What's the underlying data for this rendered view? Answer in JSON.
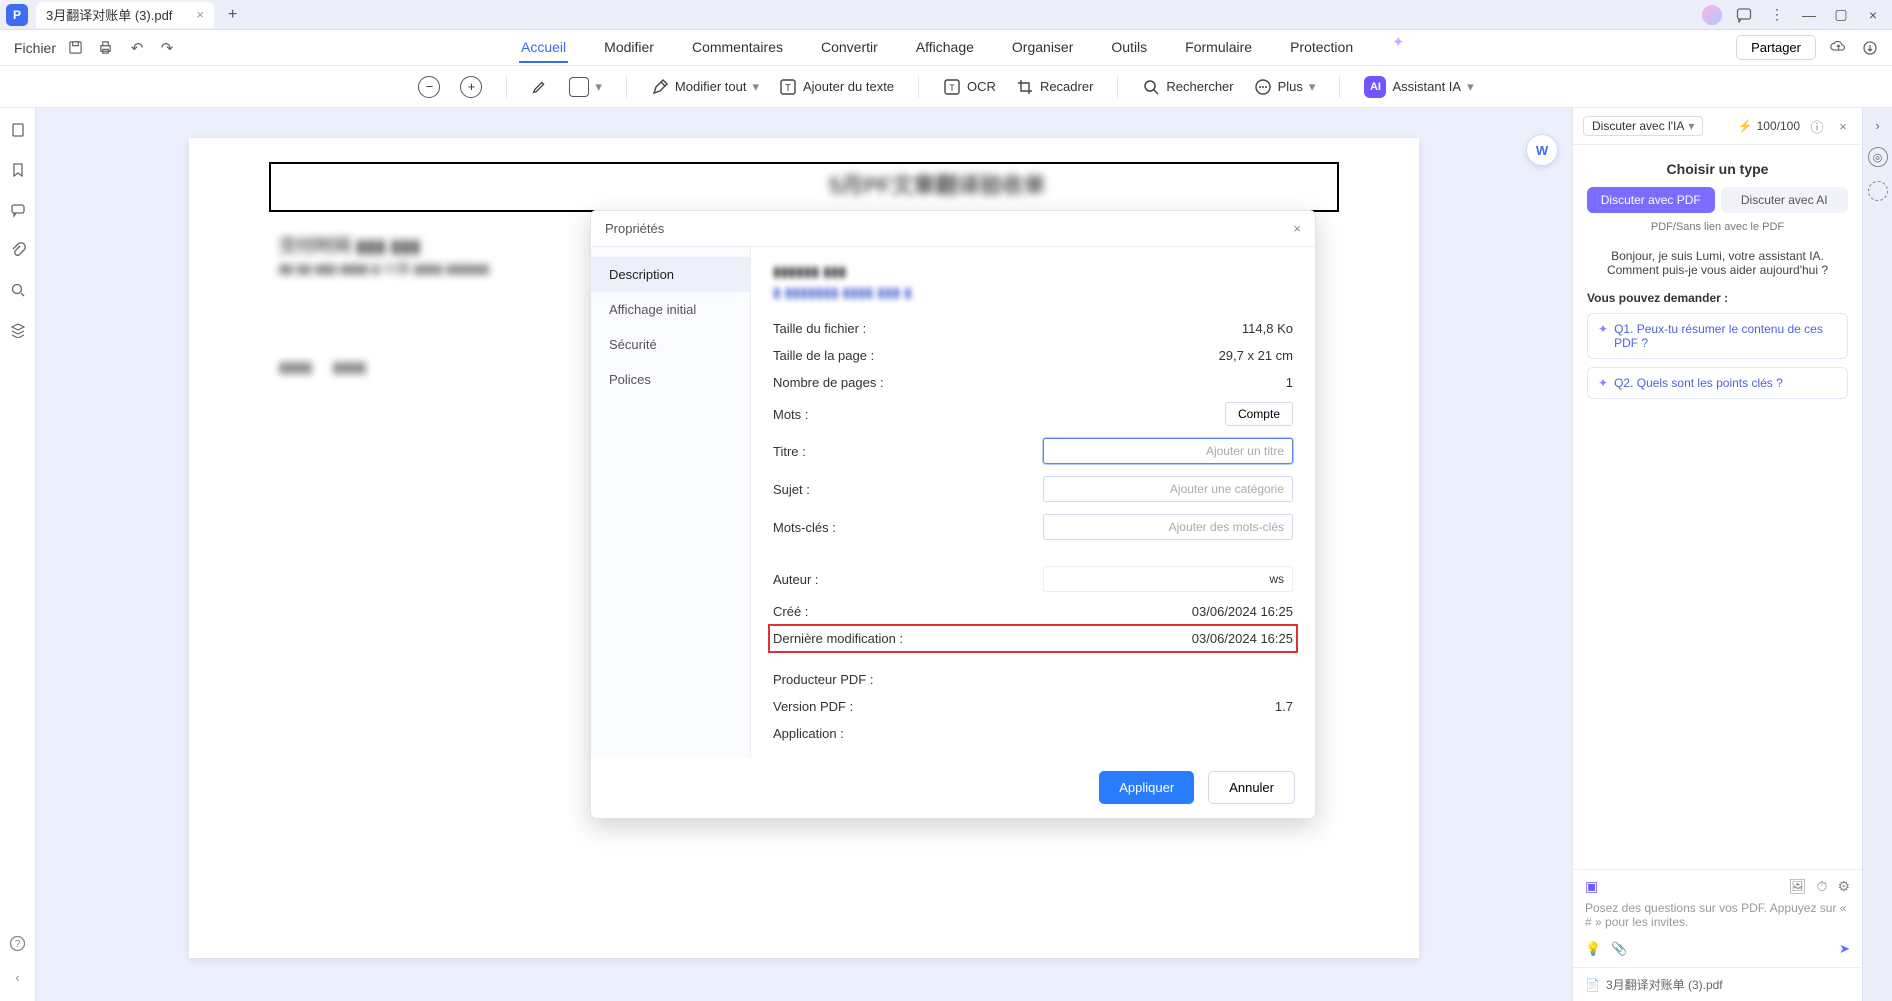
{
  "titlebar": {
    "doc_name": "3月翻译对账单 (3).pdf"
  },
  "menubar": {
    "file": "Fichier",
    "items": [
      "Accueil",
      "Modifier",
      "Commentaires",
      "Convertir",
      "Affichage",
      "Organiser",
      "Outils",
      "Formulaire",
      "Protection"
    ],
    "active_index": 0,
    "share": "Partager"
  },
  "toolbar": {
    "modify_all": "Modifier tout",
    "add_text": "Ajouter du texte",
    "ocr": "OCR",
    "crop": "Recadrer",
    "search": "Rechercher",
    "more": "Plus",
    "assistant": "Assistant IA"
  },
  "modal": {
    "title": "Propriétés",
    "tabs": {
      "description": "Description",
      "initial_view": "Affichage initial",
      "security": "Sécurité",
      "fonts": "Polices"
    },
    "fields": {
      "file_size_label": "Taille du fichier :",
      "file_size": "114,8 Ko",
      "page_size_label": "Taille de la page :",
      "page_size": "29,7 x 21 cm",
      "page_count_label": "Nombre de pages :",
      "page_count": "1",
      "words_label": "Mots :",
      "words_button": "Compte",
      "title_label": "Titre :",
      "title_placeholder": "Ajouter un titre",
      "subject_label": "Sujet :",
      "subject_placeholder": "Ajouter une catégorie",
      "keywords_label": "Mots-clés :",
      "keywords_placeholder": "Ajouter des mots-clés",
      "author_label": "Auteur :",
      "author_value": "ws",
      "created_label": "Créé :",
      "created_value": "03/06/2024 16:25",
      "modified_label": "Dernière modification :",
      "modified_value": "03/06/2024 16:25",
      "producer_label": "Producteur PDF :",
      "version_label": "Version PDF :",
      "version_value": "1.7",
      "application_label": "Application :"
    },
    "apply": "Appliquer",
    "cancel": "Annuler"
  },
  "ai_panel": {
    "chat_with": "Discuter avec l'IA",
    "credits": "100/100",
    "choose_type": "Choisir un type",
    "pill_pdf": "Discuter avec PDF",
    "pill_ai": "Discuter avec AI",
    "subnote": "PDF/Sans lien avec le PDF",
    "greeting": "Bonjour, je suis Lumi, votre assistant IA. Comment puis-je vous aider aujourd'hui ?",
    "ask_label": "Vous pouvez demander :",
    "q1": "Q1. Peux-tu résumer le contenu de ces PDF ?",
    "q2": "Q2. Quels sont les points clés ?",
    "input_placeholder": "Posez des questions sur vos PDF. Appuyez sur « # » pour les invites.",
    "foot_file": "3月翻译对账单 (3).pdf"
  }
}
